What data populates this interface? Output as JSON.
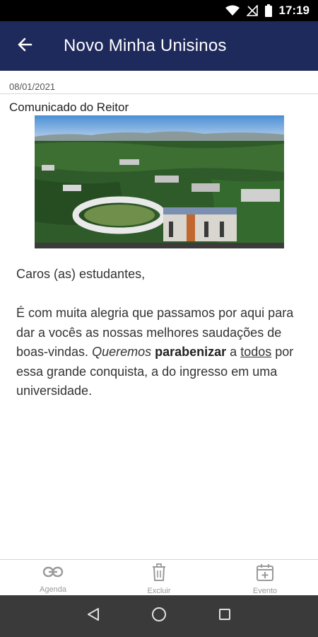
{
  "status_bar": {
    "time": "17:19",
    "icons": [
      "wifi-icon",
      "no-signal-icon",
      "battery-icon"
    ]
  },
  "app_bar": {
    "title": "Novo Minha Unisinos",
    "back_icon": "arrow-back-icon",
    "color": "#1f2a5c"
  },
  "message": {
    "date": "08/01/2021",
    "subject": "Comunicado do Reitor",
    "greeting": "Caros (as) estudantes,",
    "body_part1": "É com muita alegria que passamos por aqui para dar a vocês as nossas melhores saudações de boas-vindas. ",
    "body_italic": "Queremos",
    "body_bold": "parabenizar",
    "body_part2": " a ",
    "body_underline": "todos",
    "body_part3": " por essa grande conquista, a do ingresso em uma universidade."
  },
  "actions": [
    {
      "label": "Agenda",
      "icon": "link-icon"
    },
    {
      "label": "Excluir",
      "icon": "trash-icon"
    },
    {
      "label": "Evento",
      "icon": "calendar-add-icon"
    }
  ],
  "nav_bar": {
    "icons": [
      "back-triangle-icon",
      "home-circle-icon",
      "recents-square-icon"
    ]
  }
}
